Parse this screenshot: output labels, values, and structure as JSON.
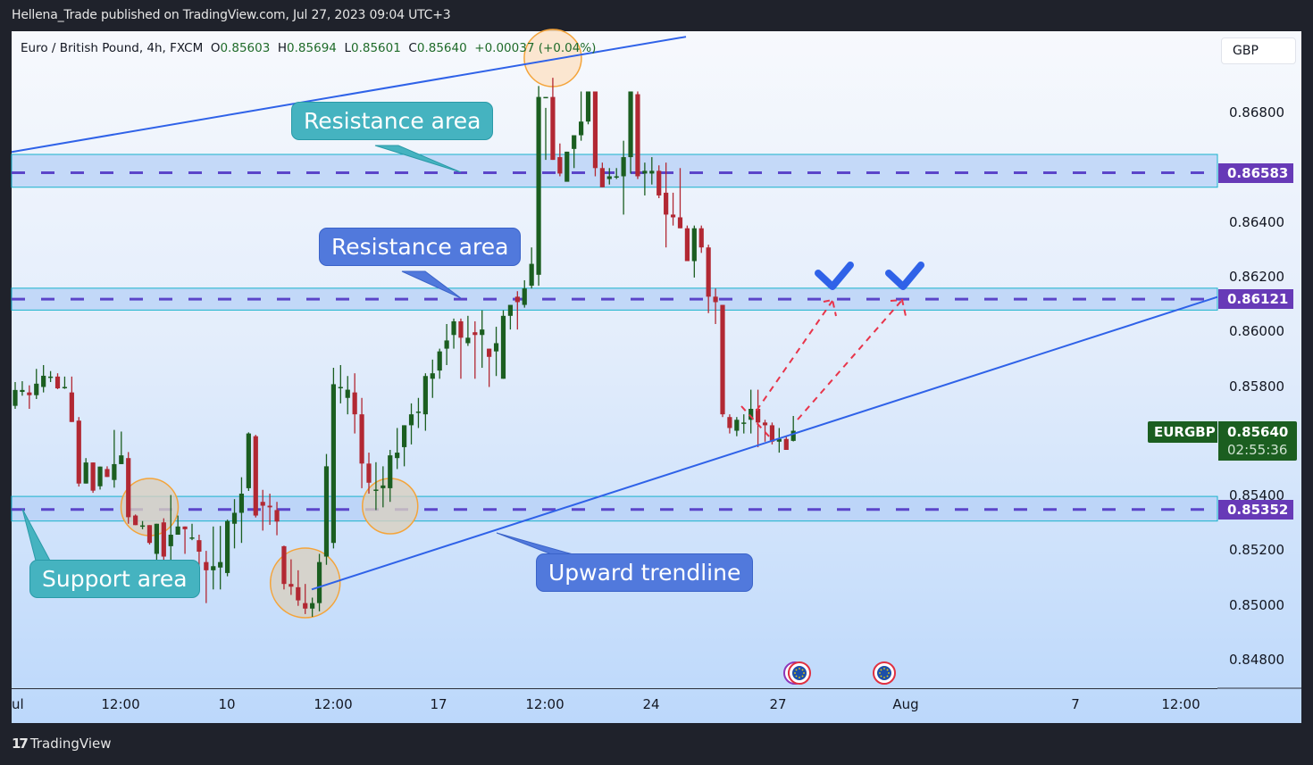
{
  "header": {
    "published_by": "Hellena_Trade published on TradingView.com, Jul 27, 2023 09:04 UTC+3"
  },
  "legend": {
    "symbol_desc": "Euro / British Pound, 4h, FXCM",
    "o_label": "O",
    "o": "0.85603",
    "h_label": "H",
    "h": "0.85694",
    "l_label": "L",
    "l": "0.85601",
    "c_label": "C",
    "c": "0.85640",
    "change": "+0.00037 (+0.04%)"
  },
  "currency_button": "GBP",
  "price_labels": {
    "res_upper": "0.86583",
    "res_lower": "0.86121",
    "support": "0.85352",
    "symbol": "EURGBP",
    "current": "0.85640",
    "countdown": "02:55:36"
  },
  "callouts": {
    "resistance_1": "Resistance area",
    "resistance_2": "Resistance area",
    "support": "Support area",
    "trendline": "Upward trendline"
  },
  "footer": {
    "brand": "TradingView",
    "brand_mark": "17"
  },
  "colors": {
    "up": "#1b5e20",
    "down": "#b22833",
    "level_line": "#5b45c9",
    "zone_fill": "#b6d0f7",
    "zone_border": "#19b3cc",
    "trendline": "#2f62e8",
    "projection": "#e8344a",
    "check": "#2f62e8",
    "circle_stroke": "#f4a43a",
    "circle_fill": "#d8cfc0"
  },
  "chart_data": {
    "type": "candlestick",
    "title": "Euro / British Pound, 4h, FXCM",
    "symbol": "EURGBP",
    "timeframe": "4h",
    "ylabel": "GBP",
    "ylim": [
      0.847,
      0.8697
    ],
    "y_ticks": [
      "0.86800",
      "0.86400",
      "0.86200",
      "0.86000",
      "0.85800",
      "0.85400",
      "0.85200",
      "0.85000",
      "0.84800"
    ],
    "x_ticks": [
      "Jul",
      "12:00",
      "10",
      "12:00",
      "17",
      "12:00",
      "24",
      "27",
      "Aug",
      "7",
      "12:00"
    ],
    "levels": [
      {
        "name": "Resistance area",
        "price": 0.86583,
        "zone": [
          0.8653,
          0.8665
        ]
      },
      {
        "name": "Resistance area",
        "price": 0.86121,
        "zone": [
          0.86081,
          0.86161
        ]
      },
      {
        "name": "Support area",
        "price": 0.85352,
        "zone": [
          0.8531,
          0.854
        ]
      }
    ],
    "upward_trendline": {
      "from": {
        "candle": 42,
        "price": 0.8506
      },
      "to_right_edge_price": 0.86129
    },
    "upper_channel": {
      "from_left_price": 0.86659,
      "to_price": 0.8708
    },
    "projections": [
      {
        "from_price": 0.8564,
        "to_price": 0.86121
      },
      {
        "from_price": 0.856,
        "to_price": 0.86121
      }
    ],
    "candles": [
      [
        0.85731,
        0.85789,
        0.8572,
        0.85818
      ],
      [
        0.85782,
        0.85789,
        0.85768,
        0.85821
      ],
      [
        0.8578,
        0.8577,
        0.8572,
        0.85806
      ],
      [
        0.8577,
        0.85812,
        0.85756,
        0.85866
      ],
      [
        0.858,
        0.85841,
        0.8578,
        0.8588
      ],
      [
        0.85838,
        0.85838,
        0.85818,
        0.85858
      ],
      [
        0.85838,
        0.85795,
        0.85792,
        0.8585
      ],
      [
        0.858,
        0.858,
        0.85793,
        0.85838
      ],
      [
        0.8578,
        0.85672,
        0.85672,
        0.85838
      ],
      [
        0.85677,
        0.85447,
        0.85436,
        0.8569
      ],
      [
        0.85447,
        0.85524,
        0.85447,
        0.8554
      ],
      [
        0.85524,
        0.85421,
        0.85413,
        0.85524
      ],
      [
        0.85437,
        0.85509,
        0.85425,
        0.85509
      ],
      [
        0.855,
        0.85471,
        0.85471,
        0.8551
      ],
      [
        0.8546,
        0.85518,
        0.85432,
        0.85643
      ],
      [
        0.85518,
        0.8555,
        0.85518,
        0.85637
      ],
      [
        0.8554,
        0.85324,
        0.853,
        0.85562
      ],
      [
        0.8533,
        0.85295,
        0.85295,
        0.85334
      ],
      [
        0.8529,
        0.85294,
        0.8528,
        0.8531
      ],
      [
        0.85295,
        0.8523,
        0.85224,
        0.85295
      ],
      [
        0.8519,
        0.853,
        0.8513,
        0.853
      ],
      [
        0.85305,
        0.8518,
        0.85102,
        0.8532
      ],
      [
        0.85218,
        0.8526,
        0.8514,
        0.85405
      ],
      [
        0.8526,
        0.8529,
        0.8526,
        0.8533
      ],
      [
        0.8529,
        0.8528,
        0.8519,
        0.8529
      ],
      [
        0.8525,
        0.8525,
        0.8524,
        0.853
      ],
      [
        0.8524,
        0.85198,
        0.85146,
        0.8526
      ],
      [
        0.8516,
        0.8513,
        0.8501,
        0.85201
      ],
      [
        0.8513,
        0.85145,
        0.8506,
        0.8529
      ],
      [
        0.8514,
        0.8516,
        0.8506,
        0.85292
      ],
      [
        0.8512,
        0.8531,
        0.85108,
        0.85315
      ],
      [
        0.853,
        0.8534,
        0.8521,
        0.8539
      ],
      [
        0.8534,
        0.8541,
        0.8523,
        0.8547
      ],
      [
        0.8543,
        0.8563,
        0.8542,
        0.85634
      ],
      [
        0.8562,
        0.8533,
        0.85323,
        0.85625
      ],
      [
        0.8538,
        0.85366,
        0.85275,
        0.85424
      ],
      [
        0.85366,
        0.8536,
        0.85296,
        0.8541
      ],
      [
        0.8535,
        0.85308,
        0.85258,
        0.8538
      ],
      [
        0.85218,
        0.8508,
        0.8506,
        0.8522
      ],
      [
        0.8508,
        0.8507,
        0.8504,
        0.8517
      ],
      [
        0.85068,
        0.8502,
        0.85,
        0.8513
      ],
      [
        0.8501,
        0.8499,
        0.8497,
        0.8508
      ],
      [
        0.8499,
        0.8501,
        0.8496,
        0.8503
      ],
      [
        0.8501,
        0.8516,
        0.8498,
        0.8519
      ],
      [
        0.8518,
        0.8551,
        0.8515,
        0.85555
      ],
      [
        0.8523,
        0.8581,
        0.8521,
        0.8587
      ],
      [
        0.858,
        0.858,
        0.8574,
        0.8588
      ],
      [
        0.8576,
        0.8579,
        0.857,
        0.8584
      ],
      [
        0.8578,
        0.857,
        0.8563,
        0.8585
      ],
      [
        0.857,
        0.8552,
        0.8543,
        0.8576
      ],
      [
        0.8552,
        0.8545,
        0.8541,
        0.8556
      ],
      [
        0.8542,
        0.85425,
        0.8535,
        0.85525
      ],
      [
        0.8543,
        0.8544,
        0.8536,
        0.8551
      ],
      [
        0.8543,
        0.8555,
        0.8538,
        0.8557
      ],
      [
        0.8554,
        0.8556,
        0.855,
        0.8565
      ],
      [
        0.8558,
        0.8566,
        0.8551,
        0.8566
      ],
      [
        0.8566,
        0.857,
        0.8559,
        0.8574
      ],
      [
        0.8571,
        0.8571,
        0.8565,
        0.8576
      ],
      [
        0.857,
        0.8584,
        0.8564,
        0.8585
      ],
      [
        0.8583,
        0.8585,
        0.8576,
        0.859
      ],
      [
        0.8586,
        0.8593,
        0.8583,
        0.8594
      ],
      [
        0.8594,
        0.8597,
        0.8588,
        0.8603
      ],
      [
        0.8599,
        0.8604,
        0.8594,
        0.8605
      ],
      [
        0.8604,
        0.8598,
        0.8583,
        0.8605
      ],
      [
        0.8596,
        0.8598,
        0.8595,
        0.8606
      ],
      [
        0.86,
        0.8599,
        0.8583,
        0.8604
      ],
      [
        0.8599,
        0.8601,
        0.8587,
        0.8608
      ],
      [
        0.8594,
        0.8591,
        0.858,
        0.8594
      ],
      [
        0.8593,
        0.8596,
        0.8584,
        0.8602
      ],
      [
        0.8583,
        0.8606,
        0.8583,
        0.8608
      ],
      [
        0.8606,
        0.861,
        0.8601,
        0.861
      ],
      [
        0.8613,
        0.8611,
        0.8601,
        0.8615
      ],
      [
        0.861,
        0.8616,
        0.8609,
        0.8619
      ],
      [
        0.8617,
        0.8625,
        0.8616,
        0.8631
      ],
      [
        0.8621,
        0.8686,
        0.8617,
        0.869
      ],
      [
        0.8686,
        0.8686,
        0.8663,
        0.8682
      ],
      [
        0.8686,
        0.8663,
        0.8663,
        0.8693
      ],
      [
        0.8664,
        0.8658,
        0.8657,
        0.8669
      ],
      [
        0.8655,
        0.8666,
        0.8657,
        0.8666
      ],
      [
        0.8667,
        0.8672,
        0.866,
        0.8672
      ],
      [
        0.8672,
        0.8677,
        0.867,
        0.8688
      ],
      [
        0.8677,
        0.8688,
        0.8676,
        0.8688
      ],
      [
        0.8688,
        0.866,
        0.8657,
        0.8684
      ],
      [
        0.866,
        0.8653,
        0.8653,
        0.8662
      ],
      [
        0.8656,
        0.8657,
        0.8654,
        0.866
      ],
      [
        0.8657,
        0.8657,
        0.8656,
        0.866
      ],
      [
        0.8657,
        0.8664,
        0.8643,
        0.867
      ],
      [
        0.8664,
        0.8688,
        0.8658,
        0.8688
      ],
      [
        0.8687,
        0.8657,
        0.8656,
        0.8688
      ],
      [
        0.8658,
        0.8659,
        0.865,
        0.8662
      ],
      [
        0.8658,
        0.8659,
        0.8654,
        0.8664
      ],
      [
        0.8659,
        0.865,
        0.8649,
        0.8661
      ],
      [
        0.8651,
        0.8643,
        0.8631,
        0.8662
      ],
      [
        0.8643,
        0.8642,
        0.8639,
        0.8651
      ],
      [
        0.8642,
        0.8638,
        0.8638,
        0.866
      ],
      [
        0.8638,
        0.8626,
        0.8626,
        0.8639
      ],
      [
        0.8626,
        0.8638,
        0.862,
        0.8639
      ],
      [
        0.8638,
        0.8631,
        0.8629,
        0.8639
      ],
      [
        0.8631,
        0.8613,
        0.8607,
        0.8632
      ],
      [
        0.8613,
        0.8611,
        0.8603,
        0.8616
      ],
      [
        0.861,
        0.857,
        0.8569,
        0.861
      ],
      [
        0.8569,
        0.8565,
        0.8563,
        0.857
      ],
      [
        0.8564,
        0.8568,
        0.8562,
        0.8569
      ],
      [
        0.8567,
        0.8567,
        0.8563,
        0.857
      ],
      [
        0.8568,
        0.8572,
        0.8563,
        0.8579
      ],
      [
        0.8572,
        0.8567,
        0.8558,
        0.8579
      ],
      [
        0.8567,
        0.8566,
        0.856,
        0.8568
      ],
      [
        0.8566,
        0.856,
        0.8559,
        0.8567
      ],
      [
        0.856,
        0.8561,
        0.8556,
        0.8565
      ],
      [
        0.8561,
        0.8557,
        0.8557,
        0.8562
      ],
      [
        0.85603,
        0.8564,
        0.85601,
        0.85694
      ]
    ],
    "candle_format": [
      "open",
      "close",
      "low",
      "high"
    ],
    "events": [
      "EU flag event",
      "EU flag event"
    ]
  }
}
